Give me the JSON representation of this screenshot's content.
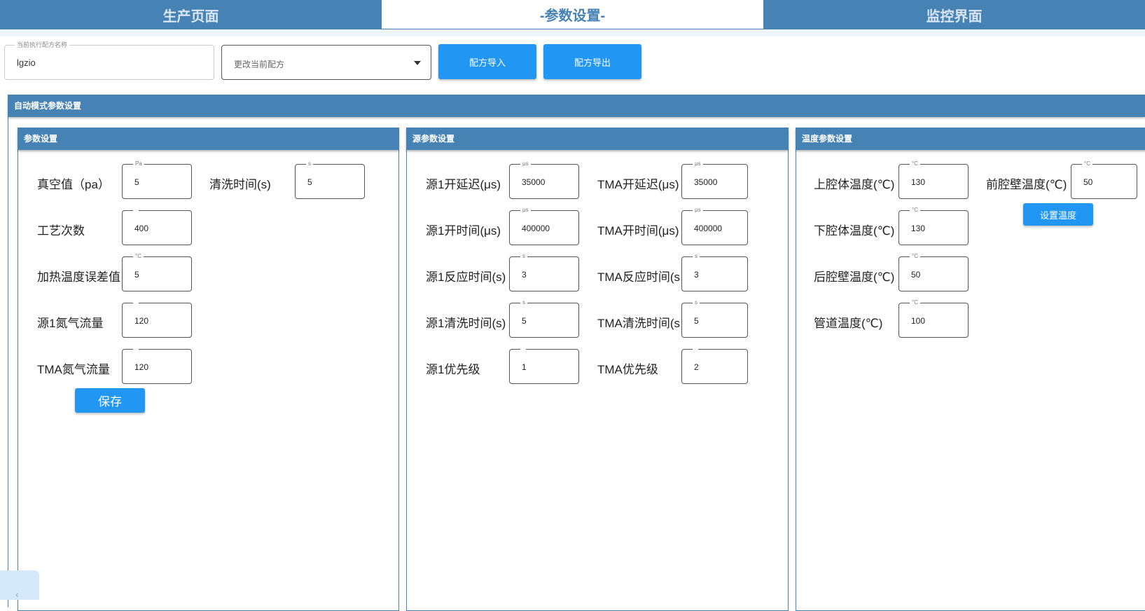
{
  "tabs": [
    {
      "label": "生产页面"
    },
    {
      "label": "-参数设置-"
    },
    {
      "label": "监控界面"
    }
  ],
  "recipe": {
    "current_legend": "当前执行配方名称",
    "current_value": "lgzio",
    "change_placeholder": "更改当前配方",
    "import_label": "配方导入",
    "export_label": "配方导出"
  },
  "section": {
    "title": "自动模式参数设置"
  },
  "params_panel": {
    "title": "参数设置",
    "vacuum": {
      "label": "真空值（pa）",
      "unit": "Pa",
      "value": "5"
    },
    "clean_time": {
      "label": "清洗时间(s)",
      "unit": "s",
      "value": "5"
    },
    "process_count": {
      "label": "工艺次数",
      "unit": "",
      "value": "400"
    },
    "heat_temp_error": {
      "label": "加热温度误差值",
      "unit": "°C",
      "value": "5"
    },
    "src1_n2_flow": {
      "label": "源1氮气流量",
      "unit": "",
      "value": "120"
    },
    "tma_n2_flow": {
      "label": "TMA氮气流量",
      "unit": "",
      "value": "120"
    },
    "save_label": "保存"
  },
  "source_panel": {
    "title": "源参数设置",
    "src1_open_delay": {
      "label": "源1开延迟(μs)",
      "unit": "μs",
      "value": "35000"
    },
    "tma_open_delay": {
      "label": "TMA开延迟(μs)",
      "unit": "μs",
      "value": "35000"
    },
    "src1_open_time": {
      "label": "源1开时间(μs)",
      "unit": "μs",
      "value": "400000"
    },
    "tma_open_time": {
      "label": "TMA开时间(μs)",
      "unit": "μs",
      "value": "400000"
    },
    "src1_react_time": {
      "label": "源1反应时间(s)",
      "unit": "s",
      "value": "3"
    },
    "tma_react_time": {
      "label": "TMA反应时间(s",
      "unit": "s",
      "value": "3"
    },
    "src1_clean_time": {
      "label": "源1清洗时间(s)",
      "unit": "s",
      "value": "5"
    },
    "tma_clean_time": {
      "label": "TMA清洗时间(s",
      "unit": "s",
      "value": "5"
    },
    "src1_priority": {
      "label": "源1优先级",
      "unit": "",
      "value": "1"
    },
    "tma_priority": {
      "label": "TMA优先级",
      "unit": "",
      "value": "2"
    }
  },
  "temp_panel": {
    "title": "温度参数设置",
    "upper_chamber": {
      "label": "上腔体温度(℃)",
      "unit": "°C",
      "value": "130"
    },
    "front_wall": {
      "label": "前腔壁温度(℃)",
      "unit": "°C",
      "value": "50"
    },
    "lower_chamber": {
      "label": "下腔体温度(℃)",
      "unit": "°C",
      "value": "130"
    },
    "rear_wall": {
      "label": "后腔壁温度(℃)",
      "unit": "°C",
      "value": "50"
    },
    "pipe": {
      "label": "管道温度(℃)",
      "unit": "°C",
      "value": "100"
    },
    "set_temp_label": "设置温度"
  },
  "colors": {
    "header_blue": "#4682b4",
    "button_blue": "#2196f3"
  }
}
